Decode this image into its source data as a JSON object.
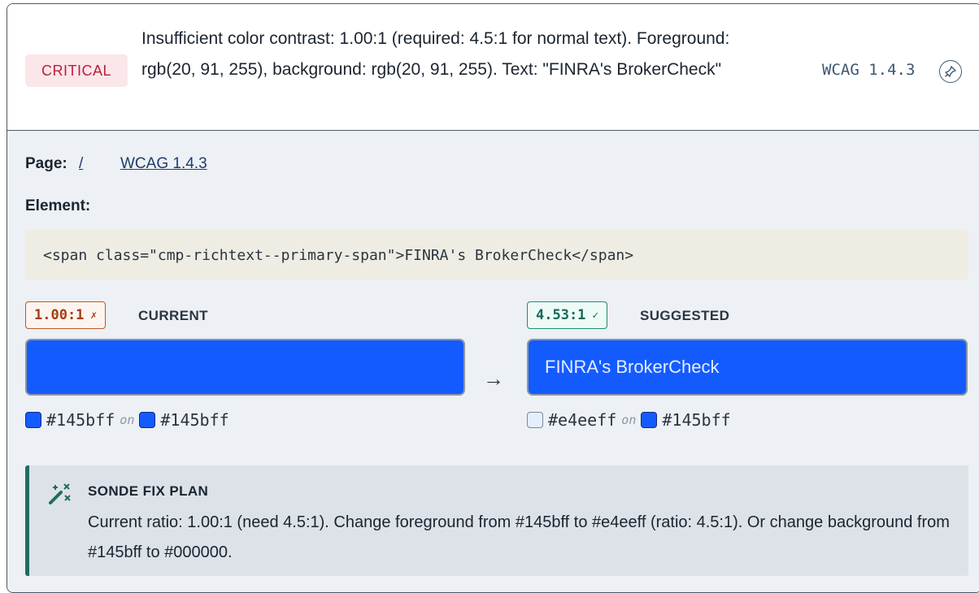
{
  "issue": {
    "severity": "CRITICAL",
    "message": "Insufficient color contrast: 1.00:1 (required: 4.5:1 for normal text). Foreground: rgb(20, 91, 255), background: rgb(20, 91, 255). Text: \"FINRA's BrokerCheck\"",
    "wcag_code": "WCAG 1.4.3",
    "pin_icon": "pin-icon"
  },
  "details": {
    "page_label": "Page:",
    "page_link": "/",
    "wcag_link": "WCAG 1.4.3",
    "element_label": "Element:",
    "element_code": "<span class=\"cmp-richtext--primary-span\">FINRA's BrokerCheck</span>"
  },
  "current": {
    "ratio": "1.00:1",
    "mark": "✗",
    "label": "CURRENT",
    "preview_text": "",
    "fg": "#145bff",
    "on": "on",
    "bg": "#145bff"
  },
  "suggested": {
    "ratio": "4.53:1",
    "mark": "✓",
    "label": "SUGGESTED",
    "preview_text": "FINRA's BrokerCheck",
    "fg": "#e4eeff",
    "on": "on",
    "bg": "#145bff"
  },
  "arrow": "→",
  "fix_plan": {
    "title": "SONDE FIX PLAN",
    "icon": "magic-wand-icon",
    "text": "Current ratio: 1.00:1 (need 4.5:1). Change foreground from #145bff to #e4eeff (ratio: 4.5:1). Or change background from #145bff to #000000."
  },
  "colors": {
    "critical_bg": "#fbe6ea",
    "critical_text": "#b8213a",
    "swatch_blue": "#145bff",
    "suggested_fg": "#e4eeff",
    "plan_accent": "#1e6d60"
  }
}
